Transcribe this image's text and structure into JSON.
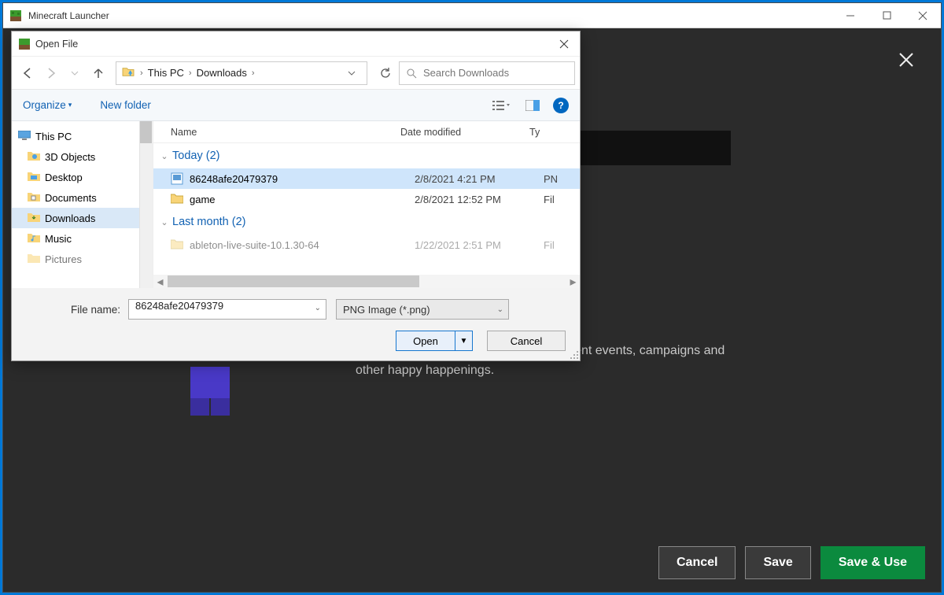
{
  "window": {
    "title": "Minecraft Launcher"
  },
  "app": {
    "description_partial": "wards players can unlock through different events, campaigns and other happy happenings.",
    "buttons": {
      "cancel": "Cancel",
      "save": "Save",
      "save_use": "Save & Use"
    }
  },
  "dialog": {
    "title": "Open File",
    "breadcrumb": {
      "pc": "This PC",
      "downloads": "Downloads"
    },
    "search_placeholder": "Search Downloads",
    "toolbar": {
      "organize": "Organize",
      "new_folder": "New folder"
    },
    "tree": {
      "root": "This PC",
      "items": [
        "3D Objects",
        "Desktop",
        "Documents",
        "Downloads",
        "Music",
        "Pictures"
      ]
    },
    "columns": {
      "name": "Name",
      "date": "Date modified",
      "type": "Ty"
    },
    "groups": {
      "today": {
        "label": "Today",
        "count": "(2)"
      },
      "last_month": {
        "label": "Last month",
        "count": "(2)"
      }
    },
    "files": [
      {
        "name": "86248afe20479379",
        "date": "2/8/2021 4:21 PM",
        "type": "PN",
        "kind": "image",
        "selected": true
      },
      {
        "name": "game",
        "date": "2/8/2021 12:52 PM",
        "type": "Fil",
        "kind": "folder",
        "selected": false
      },
      {
        "name": "ableton-live-suite-10.1.30-64",
        "date": "1/22/2021 2:51 PM",
        "type": "Fil",
        "kind": "folder",
        "selected": false
      }
    ],
    "footer": {
      "filename_label": "File name:",
      "filename_value": "86248afe20479379",
      "filter": "PNG Image (*.png)",
      "open": "Open",
      "cancel": "Cancel"
    }
  }
}
